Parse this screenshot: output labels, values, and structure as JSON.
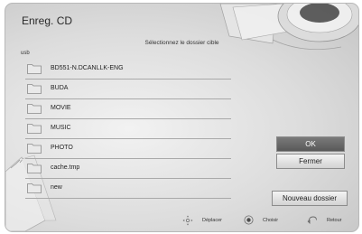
{
  "window": {
    "title": "Enreg. CD"
  },
  "header": {
    "subtitle": "Sélectionnez le dossier cible",
    "path": "usb"
  },
  "folders": [
    {
      "label": "BD551-N.DCANLLK-ENG"
    },
    {
      "label": "BUDA"
    },
    {
      "label": "MOVIE"
    },
    {
      "label": "MUSIC"
    },
    {
      "label": "PHOTO"
    },
    {
      "label": "cache.tmp"
    },
    {
      "label": "new"
    }
  ],
  "buttons": {
    "ok": "OK",
    "close": "Fermer",
    "new_folder": "Nouveau dossier"
  },
  "footer": {
    "move": "Déplacer",
    "select": "Choisir",
    "back": "Retour"
  },
  "icons": {
    "folder": "folder-icon",
    "move": "dpad-icon",
    "select": "enter-icon",
    "back": "back-icon"
  }
}
